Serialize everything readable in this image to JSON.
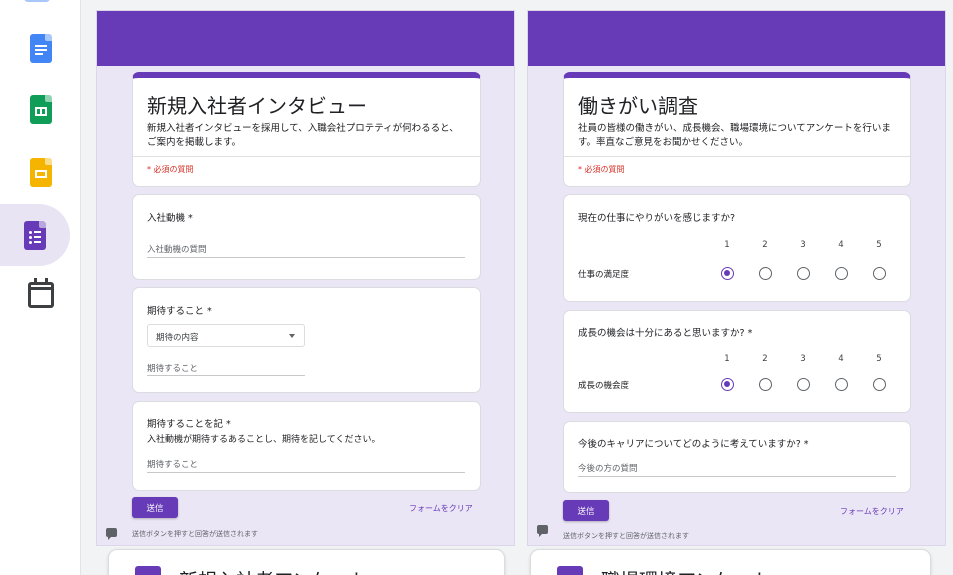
{
  "forms": [
    {
      "title": "新規入社者インタビュー",
      "description": "新規入社者インタビューを採用して、入職会社プロテティが何わるると、ご案内を掲載します。",
      "required_note": "* 必須の質問",
      "q1": {
        "title": "入社動機 *",
        "placeholder": "入社動機の質問"
      },
      "q2": {
        "title": "期待すること *",
        "dropdown_value": "期待の内容",
        "placeholder": "期待すること"
      },
      "q3": {
        "title": "期待することを記 *",
        "subtitle": "入社動機が期待するあることし、期待を記してください。",
        "placeholder": "期待すること"
      },
      "submit_label": "送信",
      "clear_label": "フォームをクリア",
      "footer": "送信ボタンを押すと回答が送信されます"
    },
    {
      "title": "働きがい調査",
      "description": "社員の皆様の働きがい、成長機会、職場環境についてアンケートを行います。率直なご意見をお聞かせください。",
      "required_note": "* 必須の質問",
      "q1": {
        "title": "現在の仕事にやりがいを感じますか?",
        "scale": [
          "1",
          "2",
          "3",
          "4",
          "5"
        ],
        "row_label": "仕事の満足度",
        "selected": 1
      },
      "q2": {
        "title": "成長の機会は十分にあると思いますか? *",
        "scale": [
          "1",
          "2",
          "3",
          "4",
          "5"
        ],
        "row_label": "成長の機会度",
        "selected": 1
      },
      "q3": {
        "title": "今後のキャリアについてどのように考えていますか? *",
        "placeholder": "今後の方の質問"
      },
      "submit_label": "送信",
      "clear_label": "フォームをクリア",
      "footer": "送信ボタンを押すと回答が送信されます"
    }
  ],
  "next_cards": [
    {
      "title": "新規入社者アンケート"
    },
    {
      "title": "職場環境アンケート"
    }
  ],
  "colors": {
    "forms_purple": "#673ab7",
    "panel_bg": "#ebe6f5",
    "required_red": "#d93025"
  },
  "rail_icons": [
    "docs-icon",
    "sheets-icon",
    "slides-icon",
    "forms-icon",
    "calendar-icon"
  ]
}
